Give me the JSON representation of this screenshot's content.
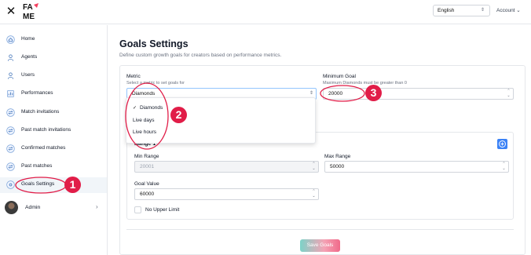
{
  "header": {
    "close_icon": "close-icon",
    "logo_text": "FA ME",
    "language": "English",
    "account_label": "Account"
  },
  "sidebar": {
    "items": [
      {
        "label": "Home",
        "icon": "home-icon"
      },
      {
        "label": "Agents",
        "icon": "agent-icon"
      },
      {
        "label": "Users",
        "icon": "user-icon"
      },
      {
        "label": "Performances",
        "icon": "chart-icon"
      },
      {
        "label": "Match invitations",
        "icon": "match-icon"
      },
      {
        "label": "Past match invitations",
        "icon": "match-icon"
      },
      {
        "label": "Confirmed matches",
        "icon": "match-icon"
      },
      {
        "label": "Past matches",
        "icon": "match-icon"
      },
      {
        "label": "Goals Settings",
        "icon": "settings-icon",
        "active": true
      }
    ],
    "admin_label": "Admin"
  },
  "main": {
    "title": "Goals Settings",
    "subtitle": "Define custom growth goals for creators based on performance metrics.",
    "metric": {
      "label": "Metric",
      "hint": "Select a metric to set goals for",
      "value": "Diamonds",
      "options": [
        "Diamonds",
        "Live days",
        "Live hours"
      ],
      "selected": "Diamonds"
    },
    "minimum_goal": {
      "label": "Minimum Goal",
      "hint": "Maximum Diamonds must be greater than 0",
      "value": "20000"
    },
    "range": {
      "title": "Range 1",
      "min_range_label": "Min Range",
      "min_range_value": "20001",
      "max_range_label": "Max Range",
      "max_range_value": "50000",
      "goal_value_label": "Goal Value",
      "goal_value": "60000",
      "no_upper_limit_label": "No Upper Limit"
    },
    "save_label": "Save Goals"
  },
  "annotations": {
    "badges": [
      "1",
      "2",
      "3"
    ],
    "color": "#e11d48"
  },
  "colors": {
    "accent": "#3b82f6",
    "active_bg": "#f1f5f9",
    "annotation": "#e11d48"
  }
}
